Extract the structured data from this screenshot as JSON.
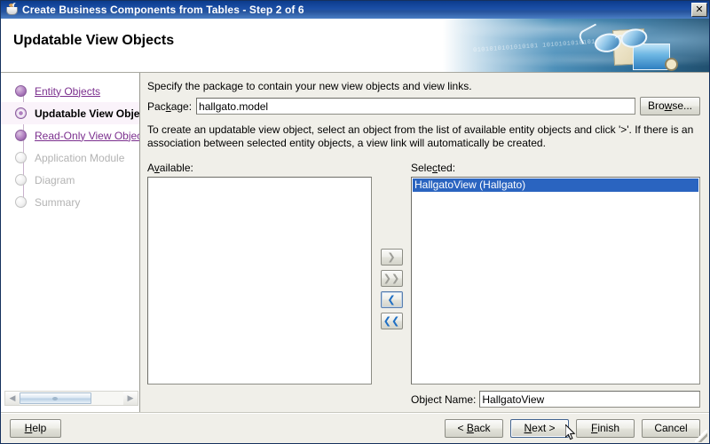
{
  "window": {
    "title": "Create Business Components from Tables - Step 2 of 6",
    "icon": "java-coffee-cup-icon",
    "close_label": "✕"
  },
  "banner": {
    "heading": "Updatable View Objects",
    "binary_text": "0101010101010101 1010101010101 010101010100"
  },
  "sidebar": {
    "steps": [
      {
        "label": "Entity Objects",
        "state": "done"
      },
      {
        "label": "Updatable View Objects",
        "state": "active"
      },
      {
        "label": "Read-Only View Objects",
        "state": "done"
      },
      {
        "label": "Application Module",
        "state": "todo"
      },
      {
        "label": "Diagram",
        "state": "todo"
      },
      {
        "label": "Summary",
        "state": "todo"
      }
    ],
    "scrollbar": {
      "left_arrow": "◀",
      "right_arrow": "▶"
    }
  },
  "main": {
    "intro": "Specify the package to contain your new view objects and view links.",
    "package": {
      "label_pre": "Pac",
      "label_mn": "k",
      "label_post": "age:",
      "value": "hallgato.model",
      "browse_pre": "Bro",
      "browse_mn": "w",
      "browse_post": "se..."
    },
    "description": "To create an updatable view object, select an object from the list of available entity objects and click '>'.  If there is an association between selected entity objects, a view link will automatically be created.",
    "available": {
      "label_pre": "A",
      "label_mn": "v",
      "label_post": "ailable:",
      "items": []
    },
    "selected": {
      "label_pre": "Sele",
      "label_mn": "c",
      "label_post": "ted:",
      "items": [
        {
          "text": "HallgatoView (Hallgato)",
          "selected": true
        }
      ]
    },
    "transfer": [
      {
        "name": "move-right-button",
        "glyph": "❯",
        "state": "disabled"
      },
      {
        "name": "move-all-right-button",
        "glyph": "❯❯",
        "state": "disabled"
      },
      {
        "name": "move-left-button",
        "glyph": "❮",
        "state": "enabled"
      },
      {
        "name": "move-all-left-button",
        "glyph": "❮❮",
        "state": "enabled"
      }
    ],
    "object_name": {
      "label": "Object Name:",
      "value": "HallgatoView"
    }
  },
  "footer": {
    "help": {
      "pre": "",
      "mn": "H",
      "post": "elp"
    },
    "back": {
      "pre": "< ",
      "mn": "B",
      "post": "ack"
    },
    "next": {
      "pre": "",
      "mn": "N",
      "post": "ext >"
    },
    "finish": {
      "pre": "",
      "mn": "F",
      "post": "inish"
    },
    "cancel": {
      "pre": "Cancel",
      "mn": "",
      "post": ""
    }
  },
  "colors": {
    "titlebar": "#1c50a8",
    "selection": "#2a64c0",
    "step_link": "#7b2f8e",
    "face": "#f0efe9"
  }
}
